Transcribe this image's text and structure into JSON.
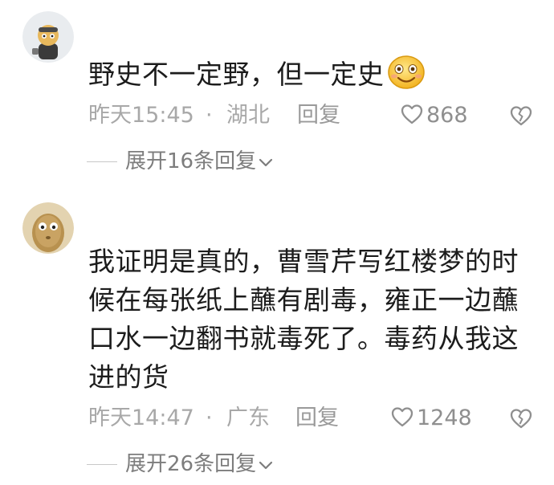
{
  "comments": [
    {
      "text": "野史不一定野，但一定史",
      "emoji": "smiling-face-emoji",
      "time": "昨天15:45",
      "separator": "·",
      "location": "湖北",
      "reply_label": "回复",
      "likes": "868",
      "expand_label": "展开16条回复"
    },
    {
      "text": "我证明是真的，曹雪芹写红楼梦的时候在每张纸上蘸有剧毒，雍正一边蘸口水一边翻书就毒死了。毒药从我这进的货",
      "time": "昨天14:47",
      "separator": "·",
      "location": "广东",
      "reply_label": "回复",
      "likes": "1248",
      "expand_label": "展开26条回复"
    }
  ],
  "colors": {
    "meta_text": "#a8a8a8",
    "body_text": "#1c1c1c",
    "expand_text": "#7d7d7d"
  },
  "icons": [
    "heart-outline-icon",
    "broken-heart-icon",
    "chevron-down-icon"
  ]
}
